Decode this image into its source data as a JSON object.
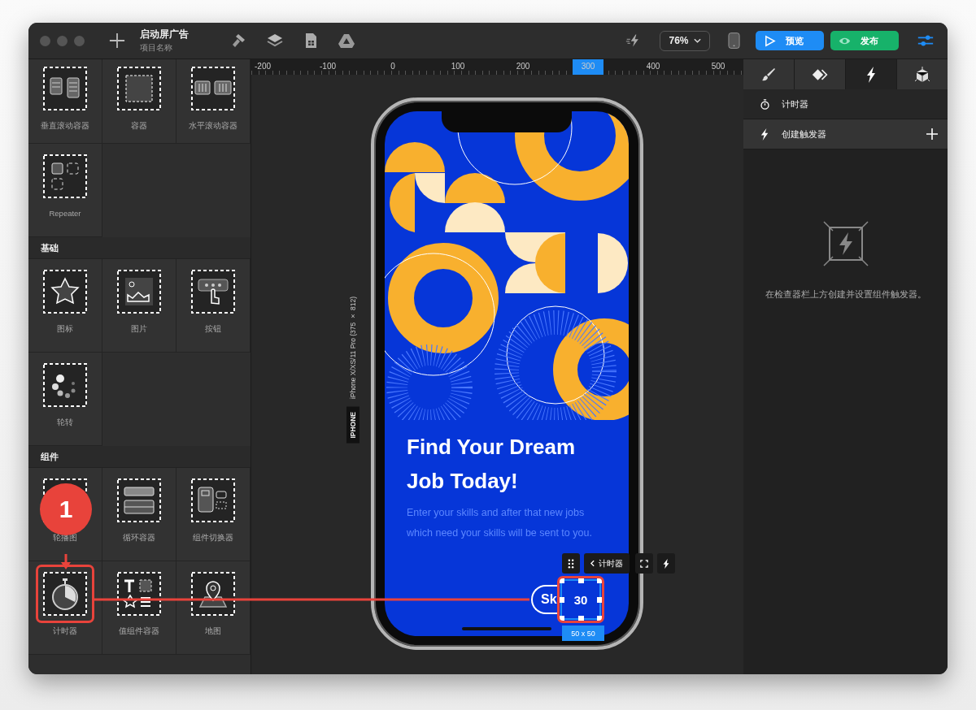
{
  "window": {
    "title": "启动屏广告",
    "subtitle": "项目名称"
  },
  "toolbar": {
    "zoom": "76%",
    "buttons": [
      {
        "label": "预览",
        "kind": "preview"
      },
      {
        "label": "发布",
        "kind": "publish"
      }
    ]
  },
  "ruler": {
    "ticks": [
      {
        "label": "-200",
        "selected": false
      },
      {
        "label": "-100",
        "selected": false
      },
      {
        "label": "0",
        "selected": false
      },
      {
        "label": "100",
        "selected": false
      },
      {
        "label": "200",
        "selected": false
      },
      {
        "label": "300",
        "selected": true
      },
      {
        "label": "400",
        "selected": false
      },
      {
        "label": "500",
        "selected": false
      }
    ]
  },
  "component_panel": {
    "sections": [
      {
        "items": [
          {
            "label": "垂直滚动容器",
            "kind": "vscroll",
            "highlighted": false
          },
          {
            "label": "容器",
            "kind": "container",
            "highlighted": false
          },
          {
            "label": "水平滚动容器",
            "kind": "hscroll",
            "highlighted": false
          },
          {
            "label": "Repeater",
            "kind": "repeater",
            "highlighted": false
          }
        ]
      },
      {
        "title": "基础",
        "items": [
          {
            "label": "图标",
            "kind": "icon",
            "highlighted": false
          },
          {
            "label": "图片",
            "kind": "image",
            "highlighted": false
          },
          {
            "label": "按钮",
            "kind": "button",
            "highlighted": false
          },
          {
            "label": "轮转",
            "kind": "spinner",
            "highlighted": false
          }
        ]
      },
      {
        "title": "组件",
        "items": [
          {
            "label": "轮播图",
            "kind": "carousel",
            "highlighted": false
          },
          {
            "label": "循环容器",
            "kind": "loop",
            "highlighted": false
          },
          {
            "label": "组件切换器",
            "kind": "switcher",
            "highlighted": false
          },
          {
            "label": "计时器",
            "kind": "timer",
            "highlighted": true
          },
          {
            "label": "值组件容器",
            "kind": "value",
            "highlighted": false
          },
          {
            "label": "地图",
            "kind": "map",
            "highlighted": false
          }
        ]
      }
    ]
  },
  "device": {
    "name": "iPhone X/XS/11 Pro (375 × 812)",
    "type_label": "IPHONE"
  },
  "screen": {
    "headline_lines": [
      "Find Your Dream",
      "Job Today!"
    ],
    "body_lines": [
      "Enter your skills and after that new jobs",
      "which need your skills will be sent to you."
    ],
    "skip_button": "Sk",
    "timer": "30",
    "selection_size": "50 x 50",
    "selection_label": "计时器"
  },
  "inspector": {
    "tabs": [
      {
        "kind": "style",
        "selected": false
      },
      {
        "kind": "layout",
        "selected": false
      },
      {
        "kind": "trigger",
        "selected": true
      },
      {
        "kind": "component",
        "selected": false
      }
    ],
    "component": "计时器",
    "add_trigger": "创建触发器",
    "empty_hint": "在检查器栏上方创建并设置组件触发器。"
  },
  "callout": {
    "label": "1"
  }
}
